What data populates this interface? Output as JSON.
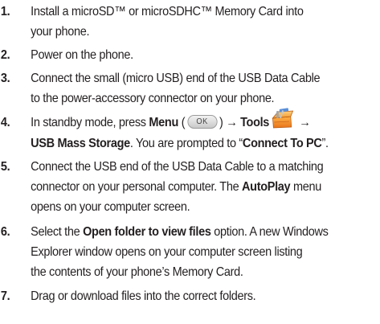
{
  "steps": [
    {
      "num": "1.",
      "lines": [
        "Install a microSD™ or microSDHC™ Memory Card into",
        "your phone."
      ]
    },
    {
      "num": "2.",
      "lines": [
        "Power on the phone."
      ]
    },
    {
      "num": "3.",
      "lines": [
        "Connect the small (micro USB) end of the USB Data Cable",
        "to the power-accessory connector on your phone."
      ]
    },
    {
      "num": "4.",
      "line1": {
        "a": "In standby mode, press ",
        "menu": "Menu",
        "open_paren": " (",
        "key_label": "OK",
        "close_arrow": ") → ",
        "tools": "Tools",
        "arrow2": " →"
      },
      "line2": {
        "usb": "USB Mass Storage",
        "mid": ". You are prompted to “",
        "connect": "Connect To PC",
        "end": "”."
      }
    },
    {
      "num": "5.",
      "line1": "Connect the USB end of the USB Data Cable to a matching",
      "line2": {
        "a": "connector on your personal computer. The ",
        "autoplay": "AutoPlay",
        "b": " menu"
      },
      "line3": "opens on your computer screen."
    },
    {
      "num": "6.",
      "line1": {
        "a": "Select the ",
        "bold": "Open folder to view files",
        "b": " option. A new Windows"
      },
      "line2": "Explorer window opens on your computer screen listing",
      "line3": "the contents of your phone’s Memory Card."
    },
    {
      "num": "7.",
      "lines": [
        "Drag or download files into the correct folders."
      ]
    }
  ],
  "icons": {
    "ok_key": "ok-key-icon",
    "tools": "tools-icon"
  }
}
